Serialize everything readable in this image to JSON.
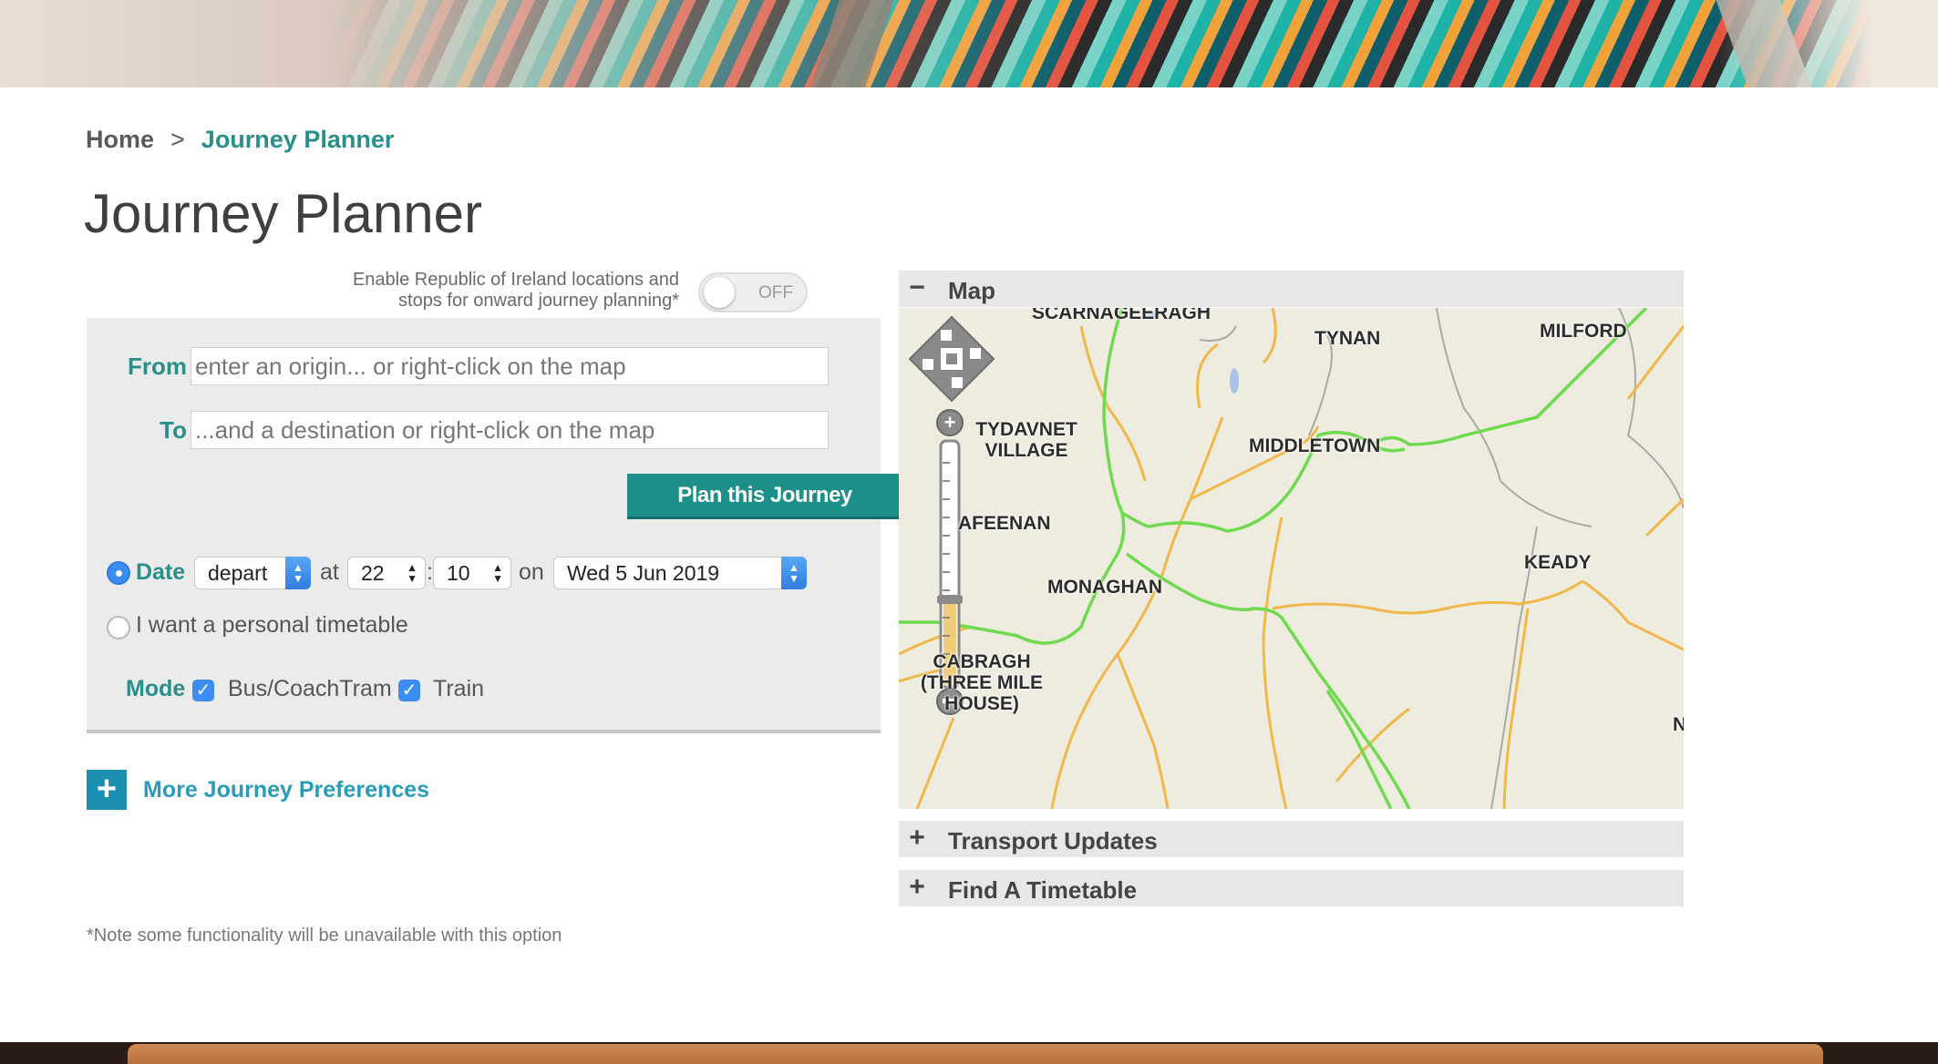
{
  "breadcrumb": {
    "home": "Home",
    "separator": ">",
    "current": "Journey Planner"
  },
  "page_title": "Journey Planner",
  "roi_toggle": {
    "text": "Enable Republic of Ireland locations and stops for onward journey planning*",
    "state": "OFF"
  },
  "form": {
    "from_label": "From",
    "from_placeholder": "enter an origin... or right-click on the map",
    "to_label": "To",
    "to_placeholder": "...and a destination or right-click on the map",
    "plan_button": "Plan this Journey",
    "date_label": "Date",
    "depart_select": "depart",
    "at_label": "at",
    "hour": "22",
    "time_sep": ":",
    "minute": "10",
    "on_label": "on",
    "date_value": "Wed 5 Jun 2019",
    "timetable_label": "I want a personal timetable",
    "mode_label": "Mode",
    "mode_bus": "Bus/CoachTram",
    "mode_train": "Train"
  },
  "preferences": {
    "icon": "+",
    "label": "More Journey Preferences"
  },
  "footnote": "*Note some functionality will be unavailable with this option",
  "accordion": {
    "map": {
      "sign": "−",
      "title": "Map"
    },
    "transport": {
      "sign": "+",
      "title": "Transport Updates"
    },
    "timetable": {
      "sign": "+",
      "title": "Find A Timetable"
    }
  },
  "map_places": {
    "scarnageeragh": "SCARNAGEERAGH",
    "tynan": "TYNAN",
    "milford": "MILFORD",
    "tydavnet": "TYDAVNET VILLAGE",
    "middletown": "MIDDLETOWN",
    "afeenan": "AFEENAN",
    "keady": "KEADY",
    "monaghan": "MONAGHAN",
    "cabragh": "CABRAGH (THREE MILE HOUSE)",
    "n": "N"
  },
  "colors": {
    "accent": "#2a8f8a",
    "button": "#1c8f88",
    "link": "#2a9bb8",
    "road_green": "#6fd94f",
    "road_orange": "#f0b84a"
  }
}
